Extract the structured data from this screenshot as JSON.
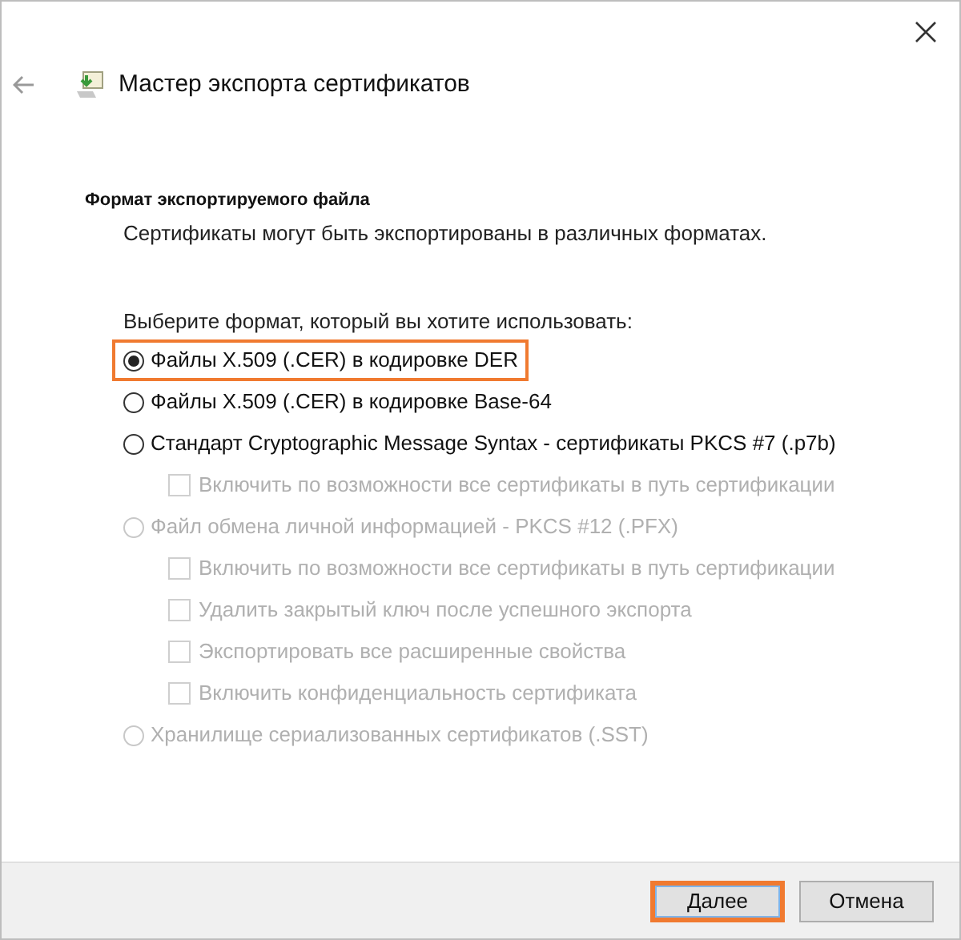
{
  "window": {
    "title": "Мастер экспорта сертификатов"
  },
  "page": {
    "heading": "Формат экспортируемого файла",
    "description": "Сертификаты могут быть экспортированы в различных форматах."
  },
  "prompt": "Выберите формат, который вы хотите использовать:",
  "options": [
    {
      "kind": "radio",
      "label": "Файлы X.509 (.CER) в кодировке DER",
      "selected": true,
      "disabled": false,
      "highlighted": true
    },
    {
      "kind": "radio",
      "label": "Файлы X.509 (.CER) в кодировке Base-64",
      "selected": false,
      "disabled": false,
      "highlighted": false
    },
    {
      "kind": "radio",
      "label": "Стандарт Cryptographic Message Syntax - сертификаты PKCS #7 (.p7b)",
      "selected": false,
      "disabled": false,
      "highlighted": false
    },
    {
      "kind": "checkbox",
      "label": "Включить по возможности все сертификаты в путь сертификации",
      "checked": false,
      "disabled": true
    },
    {
      "kind": "radio",
      "label": "Файл обмена личной информацией - PKCS #12 (.PFX)",
      "selected": false,
      "disabled": true,
      "highlighted": false
    },
    {
      "kind": "checkbox",
      "label": "Включить по возможности все сертификаты в путь сертификации",
      "checked": false,
      "disabled": true
    },
    {
      "kind": "checkbox",
      "label": "Удалить закрытый ключ после успешного экспорта",
      "checked": false,
      "disabled": true
    },
    {
      "kind": "checkbox",
      "label": "Экспортировать все расширенные свойства",
      "checked": false,
      "disabled": true
    },
    {
      "kind": "checkbox",
      "label": "Включить конфиденциальность сертификата",
      "checked": false,
      "disabled": true
    },
    {
      "kind": "radio",
      "label": "Хранилище сериализованных сертификатов (.SST)",
      "selected": false,
      "disabled": true,
      "highlighted": false
    }
  ],
  "buttons": [
    {
      "label": "Далее",
      "highlighted": true
    },
    {
      "label": "Отмена",
      "highlighted": false
    }
  ]
}
